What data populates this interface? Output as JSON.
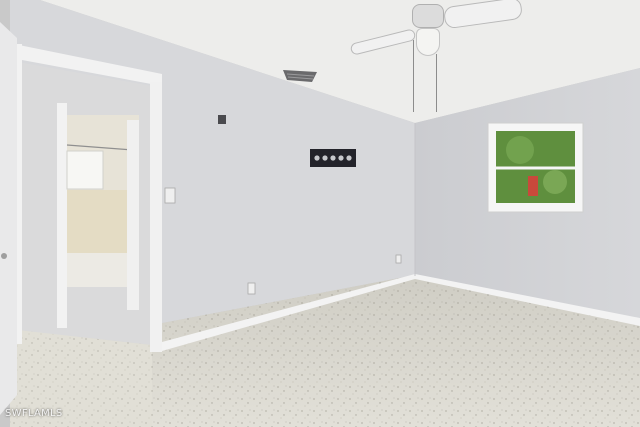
{
  "watermark": {
    "text": "SWFLAMLS"
  },
  "colors": {
    "ceiling": "#ededeb",
    "left_wall": "#d7d8db",
    "back_wall": "#d0d1d4",
    "floor": "#d6d4cb",
    "baseboard": "#f3f3f3",
    "window_foliage": "#5f8f3e",
    "bathroom_wall": "#e4dcc4"
  },
  "icons": {
    "fan": "ceiling-fan-icon",
    "vent": "air-vent-icon",
    "outlet": "electrical-outlet-icon",
    "switch": "light-switch-icon"
  }
}
